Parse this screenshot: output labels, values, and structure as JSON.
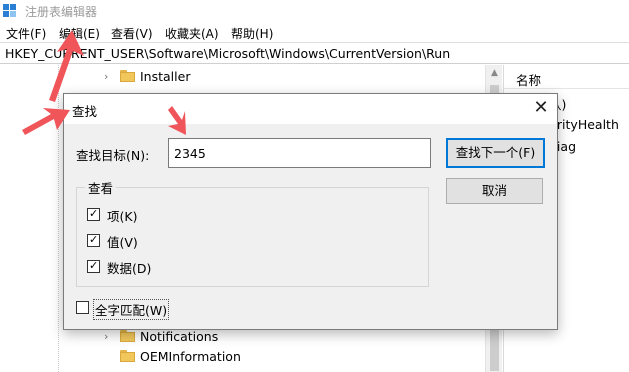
{
  "app": {
    "title": "注册表编辑器",
    "icon": "regedit-icon"
  },
  "menu": {
    "items": [
      "文件(F)",
      "编辑(E)",
      "查看(V)",
      "收藏夹(A)",
      "帮助(H)"
    ]
  },
  "address": {
    "path": "HKEY_CURRENT_USER\\Software\\Microsoft\\Windows\\CurrentVersion\\Run"
  },
  "tree": {
    "items": [
      "Installer",
      "Notifications",
      "OEMInformation"
    ]
  },
  "values_pane": {
    "column_name": "名称",
    "fragments": [
      "认)",
      "urityHealth",
      "diag"
    ]
  },
  "find_dialog": {
    "title": "查找",
    "close_icon": "close-icon",
    "find_label": "查找目标(N):",
    "find_value": "2345",
    "find_next_label": "查找下一个(F)",
    "cancel_label": "取消",
    "look_at": {
      "title": "查看",
      "keys_label": "项(K)",
      "values_label": "值(V)",
      "data_label": "数据(D)",
      "keys_checked": true,
      "values_checked": true,
      "data_checked": true
    },
    "whole_string_label": "全字匹配(W)",
    "whole_string_checked": false
  },
  "colors": {
    "annotation_arrow": "#f0555a",
    "focus_border": "#0078d7"
  }
}
